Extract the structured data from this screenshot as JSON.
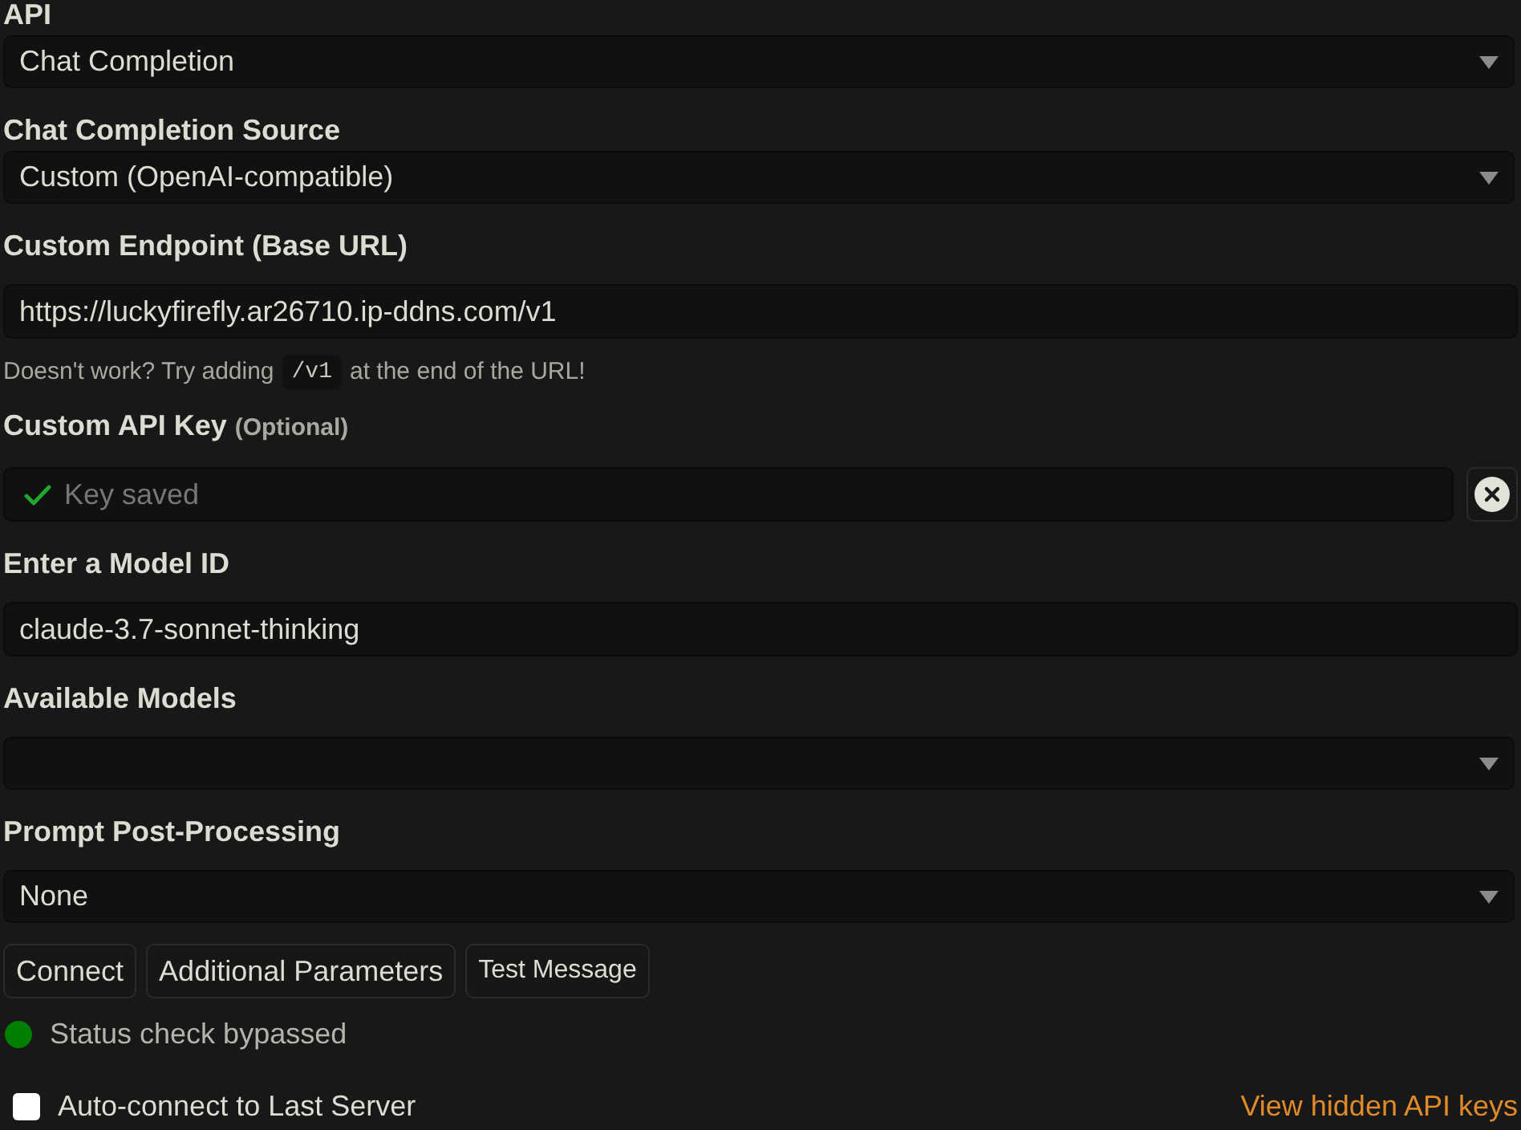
{
  "fields": [
    {
      "kind": "select",
      "label": "API",
      "value": "Chat Completion"
    },
    {
      "kind": "select",
      "label": "Chat Completion Source",
      "value": "Custom (OpenAI-compatible)"
    },
    {
      "kind": "text",
      "label": "Custom Endpoint (Base URL)",
      "value": "https://luckyfirefly.ar26710.ip-ddns.com/v1",
      "hint": {
        "before": "Doesn't work? Try adding",
        "code": "/v1",
        "after": "at the end of the URL!"
      }
    },
    {
      "kind": "secret",
      "label": "Custom API Key",
      "note": "(Optional)",
      "placeholder": "Key saved",
      "saved": true
    },
    {
      "kind": "text",
      "label": "Enter a Model ID",
      "value": "claude-3.7-sonnet-thinking"
    },
    {
      "kind": "select",
      "label": "Available Models"
    },
    {
      "kind": "select",
      "label": "Prompt Post-Processing",
      "value": "None"
    }
  ],
  "buttons": [
    "Connect",
    "Additional Parameters",
    "Test Message"
  ],
  "status": {
    "text": "Status check bypassed",
    "color": "#008000"
  },
  "auto_connect": {
    "label": "Auto-connect to Last Server",
    "checked": false
  },
  "link": "View hidden API keys"
}
